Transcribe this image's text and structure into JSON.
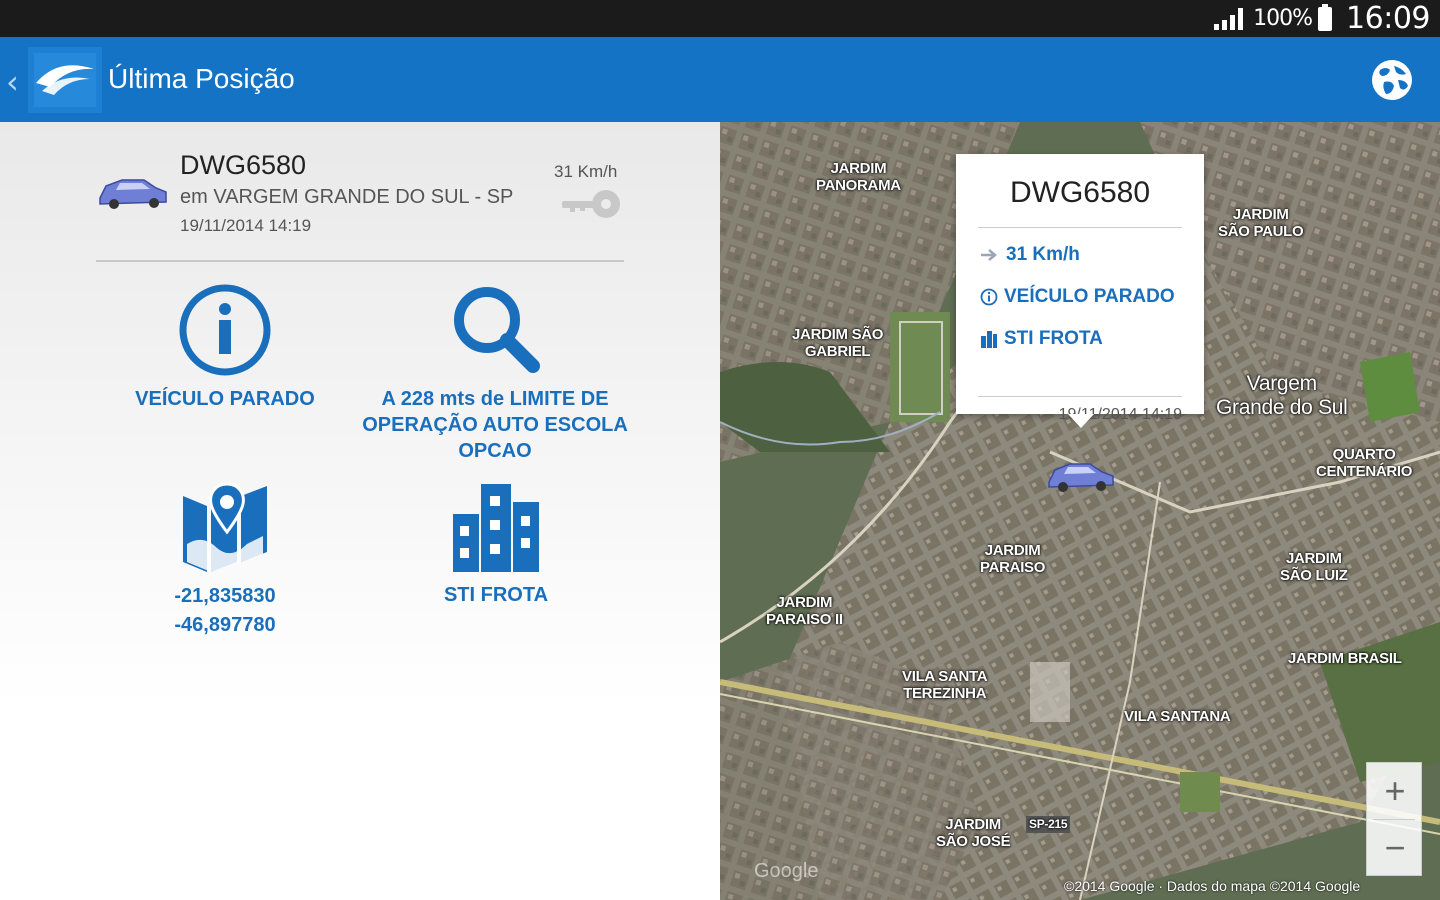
{
  "status_bar": {
    "battery_text": "100%",
    "time": "16:09"
  },
  "app_bar": {
    "title": "Última Posição",
    "back_glyph": "‹",
    "icons": {
      "globe": "globe-icon",
      "logo": "app-logo-icon"
    }
  },
  "vehicle": {
    "plate": "DWG6580",
    "location": "em VARGEM GRANDE DO SUL - SP",
    "timestamp": "19/11/2014 14:19",
    "speed": "31 Km/h"
  },
  "tiles": {
    "status_label": "VEÍCULO PARADO",
    "geofence_lines": [
      "A 228 mts de LIMITE DE",
      "OPERAÇÃO AUTO ESCOLA",
      "OPCAO"
    ],
    "coords": {
      "lat": "-21,835830",
      "lon": "-46,897780"
    },
    "company_label": "STI FROTA"
  },
  "map": {
    "popup": {
      "plate": "DWG6580",
      "speed": "31 Km/h",
      "status": "VEÍCULO PARADO",
      "company": "STI FROTA",
      "timestamp": "19/11/2014 14:19"
    },
    "labels": {
      "jardim_panorama": [
        "JARDIM",
        "PANORAMA"
      ],
      "jardim_sao_paulo": [
        "JARDIM",
        "SÃO PAULO"
      ],
      "jardim_sao_gabriel": [
        "JARDIM SÃO",
        "GABRIEL"
      ],
      "vargem": [
        "Vargem",
        "Grande do Sul"
      ],
      "quarto_centenario": [
        "QUARTO",
        "CENTENÁRIO"
      ],
      "jardim_paraiso": [
        "JARDIM",
        "PARAISO"
      ],
      "jardim_paraiso_ii": [
        "JARDIM",
        "PARAISO II"
      ],
      "jardim_sao_luiz": [
        "JARDIM",
        "SÃO LUIZ"
      ],
      "jardim_brasil": "JARDIM BRASIL",
      "vila_santa_terezinha": [
        "VILA SANTA",
        "TEREZINHA"
      ],
      "vila_santana": "VILA SANTANA",
      "jardim_sao_jose": [
        "JARDIM",
        "SÃO JOSÉ"
      ],
      "highway": "SP-215"
    },
    "zoom_in": "+",
    "zoom_out": "−",
    "attribution": "©2014 Google · Dados do mapa ©2014 Google",
    "google": "Google"
  },
  "colors": {
    "primary": "#1473c4",
    "accent_text": "#1a6fbd",
    "status_bar": "#1b1b1b"
  }
}
